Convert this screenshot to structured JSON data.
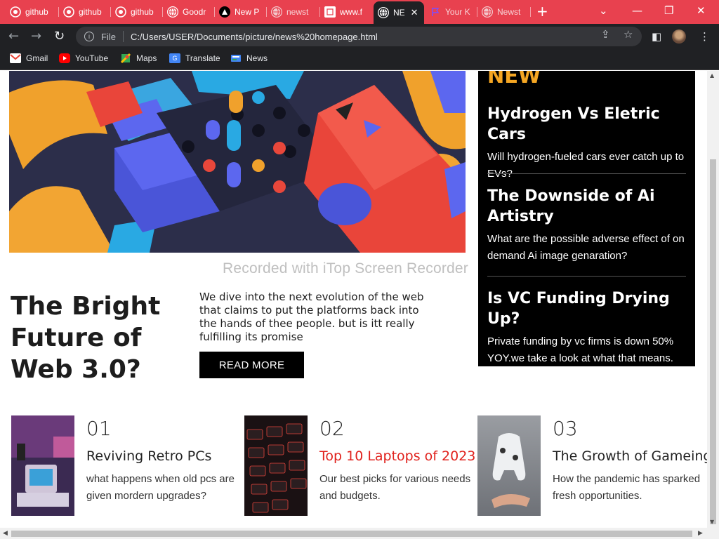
{
  "browser": {
    "tabs": [
      {
        "title": "github",
        "icon": "github-icon"
      },
      {
        "title": "github",
        "icon": "github-icon"
      },
      {
        "title": "github",
        "icon": "github-icon"
      },
      {
        "title": "Goodr",
        "icon": "globe-icon"
      },
      {
        "title": "New P",
        "icon": "triangle-icon"
      },
      {
        "title": "newst",
        "icon": "globe-icon"
      },
      {
        "title": "www.f",
        "icon": "docs-icon"
      },
      {
        "title": "NE",
        "icon": "globe-icon",
        "active": true
      },
      {
        "title": "Your K",
        "icon": "flag-icon"
      },
      {
        "title": "Newst",
        "icon": "globe-icon"
      }
    ],
    "address": {
      "scheme_label": "File",
      "url": "C:/Users/USER/Documents/picture/news%20homepage.html"
    },
    "bookmarks": [
      {
        "label": "Gmail",
        "icon": "gmail-icon",
        "color": "#ea4335"
      },
      {
        "label": "YouTube",
        "icon": "youtube-icon",
        "color": "#ff0000"
      },
      {
        "label": "Maps",
        "icon": "maps-icon",
        "color": "#34a853"
      },
      {
        "label": "Translate",
        "icon": "translate-icon",
        "color": "#4285f4"
      },
      {
        "label": "News",
        "icon": "news-icon",
        "color": "#4285f4"
      }
    ],
    "tabbar_color": "#e8414f",
    "toolbar_color": "#202124"
  },
  "page": {
    "hero": {
      "headline": "The Bright Future of Web 3.0?",
      "lede": "We dive into the next evolution of the web that claims to put the platforms back into the hands of thee people. but is itt really fulfilling its promise",
      "button": "READ MORE"
    },
    "sidebar": {
      "heading": "NEW",
      "heading_color": "#f5a623",
      "items": [
        {
          "title": "Hydrogen Vs Eletric Cars",
          "desc": "Will hydrogen-fueled cars ever catch up to EVs?"
        },
        {
          "title": "The Downside of Ai Artistry",
          "desc": "What are the possible adverse effect of on demand Ai image genaration?"
        },
        {
          "title": "Is VC Funding Drying Up?",
          "desc": "Private funding by vc firms is down 50% YOY.we take a look at what that means."
        }
      ]
    },
    "articles": [
      {
        "num": "01",
        "title": "Reviving Retro PCs",
        "desc": "what happens when old pcs are given mordern upgrades?",
        "accent": false
      },
      {
        "num": "02",
        "title": "Top 10 Laptops of 2023",
        "desc": "Our best picks for various needs and budgets.",
        "accent": true
      },
      {
        "num": "03",
        "title": "The Growth of Gameing",
        "desc": "How the pandemic has sparked fresh opportunities.",
        "accent": false
      }
    ],
    "accent_color": "#e0211c"
  },
  "overlay": {
    "watermark": "Recorded with iTop Screen Recorder"
  }
}
